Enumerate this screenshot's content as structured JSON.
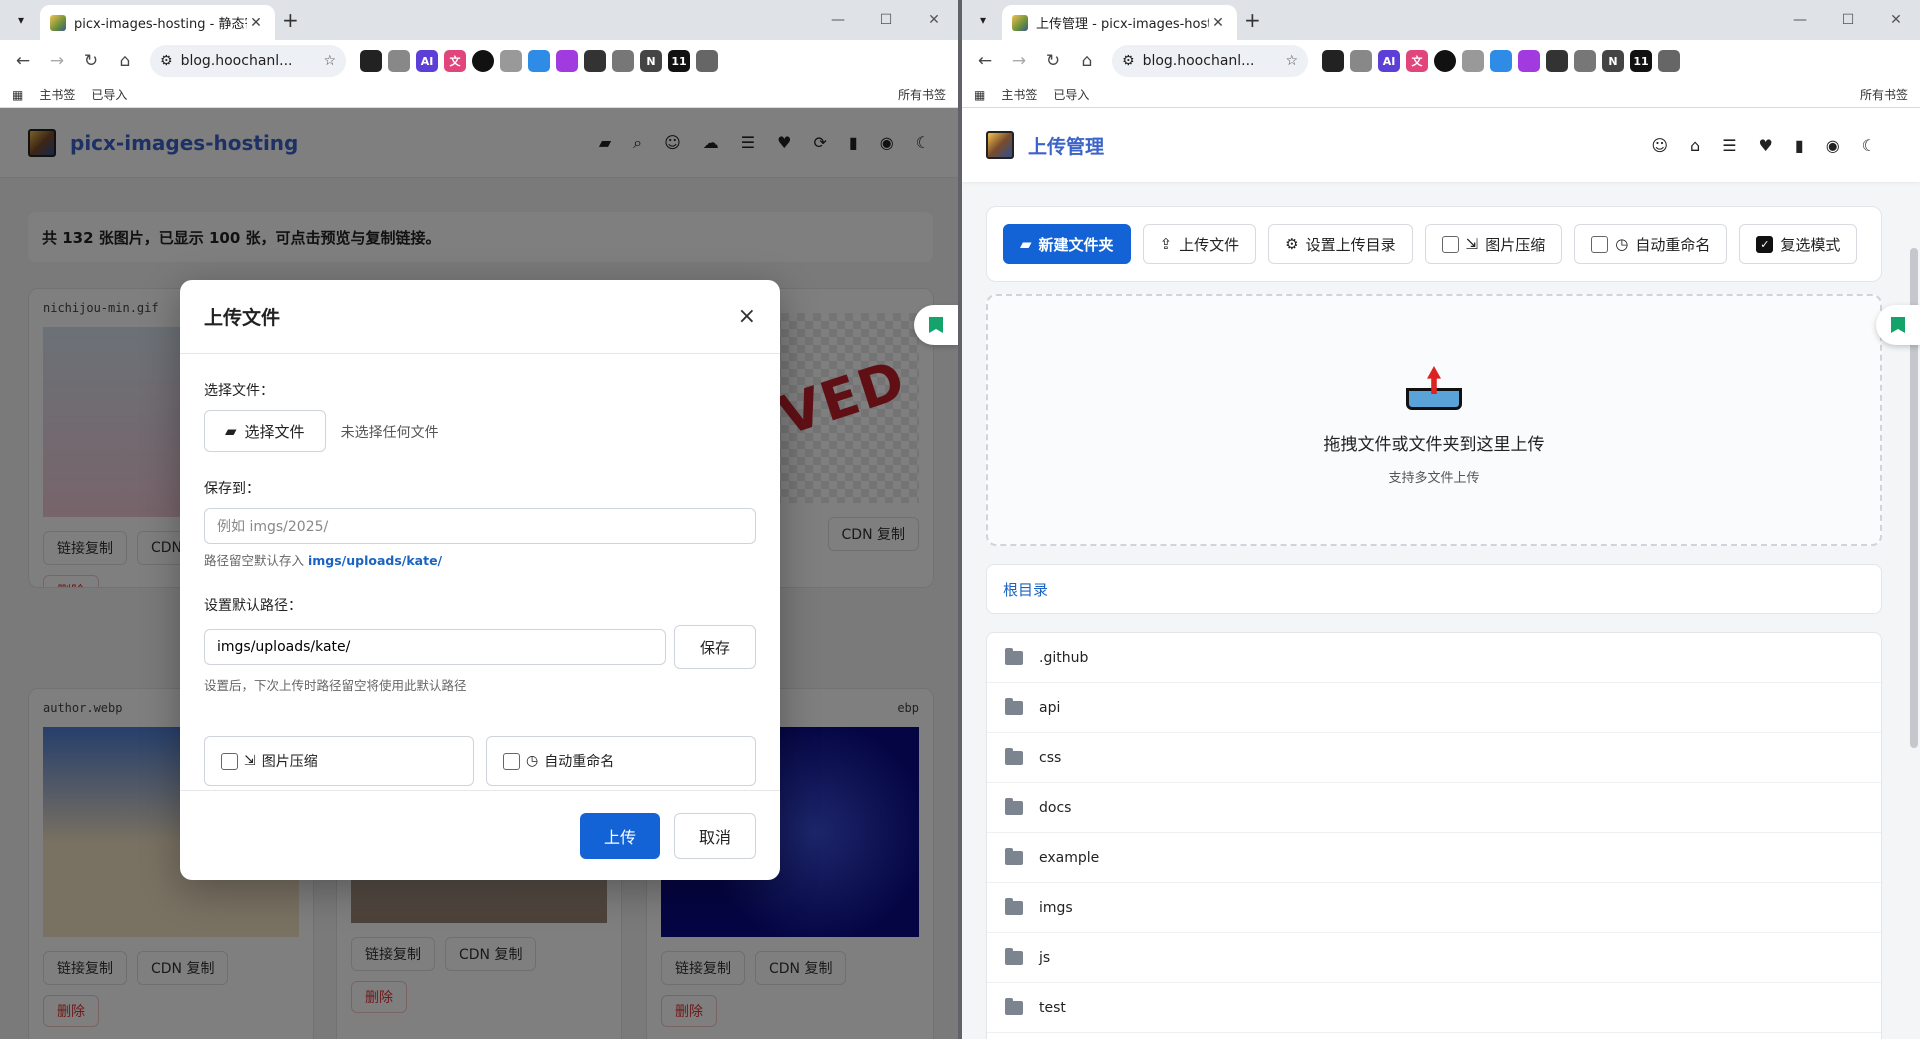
{
  "left": {
    "tab_title": "picx-images-hosting - 静态寄",
    "url": "blog.hoochanl...",
    "bookmarks": [
      "主书签",
      "已导入"
    ],
    "all_bookmarks": "所有书签",
    "brand": "picx-images-hosting",
    "notice": "共 132 张图片，已显示 100 张，可点击预览与复制链接。",
    "cards": [
      {
        "name": "nichijou-min.gif"
      },
      {
        "name": ""
      },
      {
        "name": ""
      },
      {
        "name": "author.webp"
      },
      {
        "name": ""
      },
      {
        "name": "ebp"
      }
    ],
    "card_buttons": {
      "copy": "链接复制",
      "cdn": "CDN 复制",
      "delete": "删除",
      "cdn_short": "CDN"
    },
    "stamp_text": "HIVED",
    "modal": {
      "title": "上传文件",
      "close": "×",
      "choose_label": "选择文件：",
      "choose_button": "选择文件",
      "no_file": "未选择任何文件",
      "save_to_label": "保存到：",
      "save_to_placeholder": "例如 imgs/2025/",
      "hint_prefix": "路径留空默认存入 ",
      "hint_path": "imgs/uploads/kate/",
      "default_path_label": "设置默认路径：",
      "default_path_value": "imgs/uploads/kate/",
      "save_button": "保存",
      "default_hint": "设置后，下次上传时路径留空将使用此默认路径",
      "compress": "图片压缩",
      "rename": "自动重命名",
      "upload": "上传",
      "cancel": "取消"
    }
  },
  "right": {
    "tab_title": "上传管理 - picx-images-hosti",
    "url": "blog.hoochanl...",
    "bookmarks": [
      "主书签",
      "已导入"
    ],
    "all_bookmarks": "所有书签",
    "brand": "上传管理",
    "toolbar": {
      "new_folder": "新建文件夹",
      "upload_file": "上传文件",
      "set_dir": "设置上传目录",
      "compress": "图片压缩",
      "rename": "自动重命名",
      "multi": "复选模式"
    },
    "drop_title": "拖拽文件或文件夹到这里上传",
    "drop_sub": "支持多文件上传",
    "breadcrumb": "根目录",
    "folders": [
      ".github",
      "api",
      "css",
      "docs",
      "example",
      "imgs",
      "js",
      "test"
    ]
  },
  "extensions_badge": "11",
  "colors": {
    "primary": "#1463d6",
    "brand": "#3b63c8",
    "link": "#1b63c2",
    "danger": "#dd3333"
  }
}
